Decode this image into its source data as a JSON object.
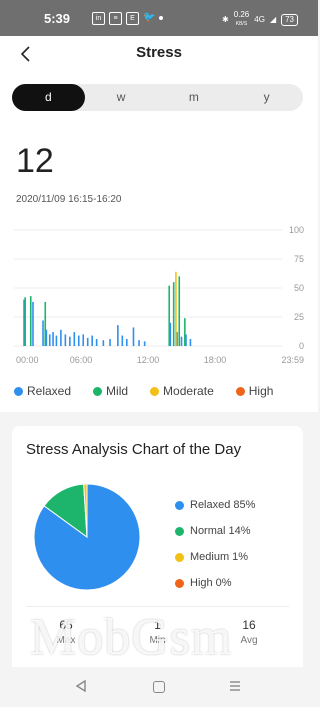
{
  "status_bar": {
    "time": "5:39",
    "app_icons": [
      "in",
      "≡",
      "E",
      "twitter"
    ],
    "network_speed": "0.26",
    "network_unit": "KB/S",
    "network_type": "4G",
    "battery": "73"
  },
  "header": {
    "title": "Stress",
    "back_icon": "chevron-left-icon"
  },
  "period_tabs": [
    {
      "label": "d",
      "active": true
    },
    {
      "label": "w",
      "active": false
    },
    {
      "label": "m",
      "active": false
    },
    {
      "label": "y",
      "active": false
    }
  ],
  "current": {
    "value": "12",
    "range": "2020/11/09 16:15-16:20"
  },
  "legend": [
    {
      "label": "Relaxed",
      "color": "#2f8fef"
    },
    {
      "label": "Mild",
      "color": "#1db56c"
    },
    {
      "label": "Moderate",
      "color": "#f2c118"
    },
    {
      "label": "High",
      "color": "#ef6418"
    }
  ],
  "chart_data": {
    "type": "bar",
    "x_ticks": [
      "00:00",
      "06:00",
      "12:00",
      "18:00",
      "23:59"
    ],
    "y_ticks": [
      100,
      75,
      50,
      25,
      0
    ],
    "ylim": [
      0,
      100
    ],
    "x_range_hours": [
      0,
      24
    ],
    "grid": true,
    "series": [
      {
        "name": "Relaxed",
        "color": "#2f8fef",
        "points": [
          [
            0.9,
            40
          ],
          [
            1.7,
            38
          ],
          [
            2.6,
            22
          ],
          [
            2.9,
            14
          ],
          [
            3.2,
            10
          ],
          [
            3.5,
            12
          ],
          [
            3.8,
            9
          ],
          [
            4.2,
            14
          ],
          [
            4.6,
            10
          ],
          [
            5.0,
            8
          ],
          [
            5.4,
            12
          ],
          [
            5.8,
            9
          ],
          [
            6.2,
            10
          ],
          [
            6.6,
            7
          ],
          [
            7.0,
            9
          ],
          [
            7.4,
            6
          ],
          [
            8.0,
            5
          ],
          [
            8.6,
            6
          ],
          [
            9.3,
            18
          ],
          [
            9.7,
            9
          ],
          [
            10.1,
            6
          ],
          [
            10.7,
            16
          ],
          [
            11.2,
            5
          ],
          [
            11.7,
            4
          ],
          [
            14.0,
            20
          ],
          [
            14.6,
            12
          ],
          [
            15.0,
            8
          ],
          [
            15.4,
            10
          ],
          [
            15.8,
            6
          ]
        ]
      },
      {
        "name": "Mild",
        "color": "#1db56c",
        "points": [
          [
            1.0,
            42
          ],
          [
            1.5,
            43
          ],
          [
            2.8,
            38
          ],
          [
            13.9,
            52
          ],
          [
            14.3,
            55
          ],
          [
            14.8,
            60
          ],
          [
            15.3,
            24
          ]
        ]
      },
      {
        "name": "Moderate",
        "color": "#f2c118",
        "points": [
          [
            14.5,
            64
          ]
        ]
      },
      {
        "name": "High",
        "color": "#ef6418",
        "points": []
      }
    ]
  },
  "analysis": {
    "title": "Stress Analysis Chart of the Day",
    "chart_data": {
      "type": "pie",
      "slices": [
        {
          "label": "Relaxed 85%",
          "value": 85,
          "color": "#2f8fef"
        },
        {
          "label": "Normal 14%",
          "value": 14,
          "color": "#1db56c"
        },
        {
          "label": "Medium 1%",
          "value": 1,
          "color": "#f2c118"
        },
        {
          "label": "High 0%",
          "value": 0,
          "color": "#ef6418"
        }
      ]
    },
    "stats": [
      {
        "value": "65",
        "label": "Max"
      },
      {
        "value": "1",
        "label": "Min"
      },
      {
        "value": "16",
        "label": "Avg"
      }
    ]
  },
  "watermark": "MobGsm",
  "nav_icons": [
    "back-icon",
    "home-icon",
    "menu-icon"
  ]
}
